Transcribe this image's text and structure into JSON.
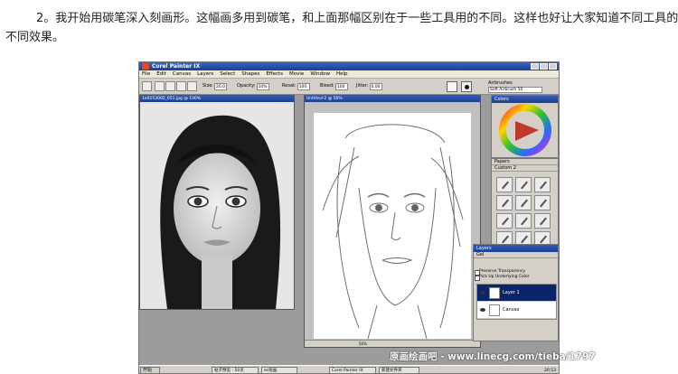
{
  "article": {
    "line1": "2。我开始用碳笔深入刻画形。这幅画多用到碳笔，和上面那幅区别在于一些工具用的不同。这样也好让大家知道不同工具的",
    "line2": "不同效果。"
  },
  "app": {
    "window_title": "Corel Painter IX",
    "menu": [
      "File",
      "Edit",
      "Canvas",
      "Layers",
      "Select",
      "Shapes",
      "Effects",
      "Movie",
      "Window",
      "Help"
    ],
    "props": {
      "size_label": "Size:",
      "size_value": "20.0",
      "opacity_label": "Opacity:",
      "opacity_value": "10%",
      "resat_label": "Resat:",
      "resat_value": "100",
      "bleed_label": "Bleed:",
      "bleed_value": "100",
      "jitter_label": "Jitter:",
      "jitter_value": "0.00"
    },
    "brush": {
      "category": "Airbrushes",
      "variant": "Soft Airbrush 50"
    },
    "photo_window_title": "1e0153002_051.jpg @ 100%",
    "sketch_window_title": "Untitled-2 @ 56%",
    "zoom_value": "56%",
    "panels": {
      "colors_title": "Colors",
      "papers_title": "Papers",
      "custom_title": "Custom 2",
      "layers_title": "Layers",
      "layer_blend": "Gel",
      "preserve_transparency": "Preserve Transparency",
      "pick_up_color": "Pick Up Underlying Color",
      "layers": [
        {
          "name": "Layer 1",
          "selected": true
        },
        {
          "name": "Canvas",
          "selected": false
        }
      ]
    },
    "taskbar": {
      "start": "开始",
      "tasks": [
        "帖子预览 - 50页",
        "ec绘画",
        "Corel Painter IX",
        "新建文件夹"
      ],
      "clock": "20:53"
    }
  },
  "watermark": "原画绘画吧 - www.linecg.com/tieba/1797",
  "colors": {
    "titlebar": "#2f5bb8",
    "panel_bg": "#d4d0c8",
    "workspace": "#9c9c9c"
  }
}
